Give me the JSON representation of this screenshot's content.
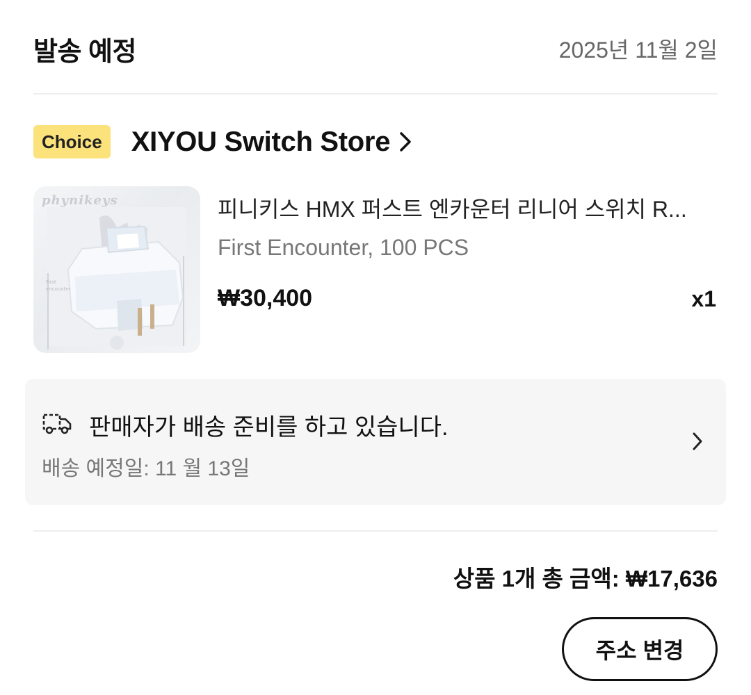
{
  "header": {
    "title": "발송 예정",
    "date": "2025년 11월 2일"
  },
  "store": {
    "badge": "Choice",
    "name": "XIYOU Switch Store",
    "badge_color": "#fbe27a"
  },
  "product": {
    "image_logo_text": "phynikeys",
    "name": "피니키스 HMX 퍼스트 엔카운터 리니어 스위치 R...",
    "variant": "First Encounter, 100 PCS",
    "price": "₩30,400",
    "quantity": "x1"
  },
  "shipping": {
    "icon": "delivery-truck-icon",
    "status": "판매자가 배송 준비를 하고 있습니다.",
    "eta": "배송 예정일: 11 월 13일"
  },
  "summary": {
    "total": "상품 1개 총 금액: ₩17,636"
  },
  "actions": {
    "change_address": "주소 변경"
  }
}
